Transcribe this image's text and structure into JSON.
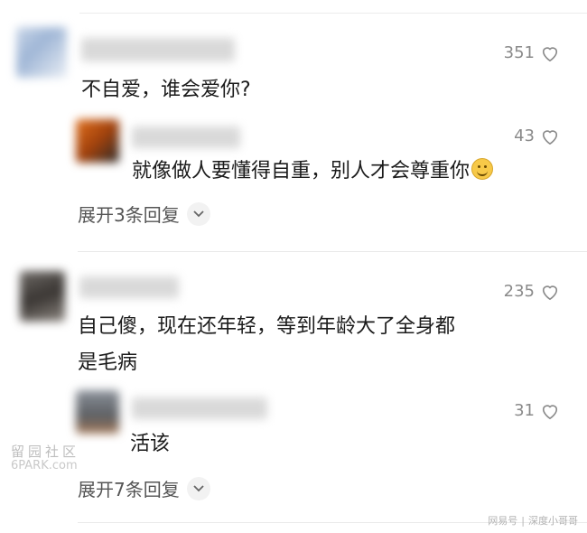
{
  "comments": [
    {
      "likes": "351",
      "text": "不自爱，谁会爱你?",
      "reply": {
        "likes": "43",
        "text": "就像做人要懂得自重，别人才会尊重你"
      },
      "expand_label": "展开3条回复"
    },
    {
      "likes": "235",
      "text_line1": "自己傻，现在还年轻，等到年龄大了全身都",
      "text_line2": "是毛病",
      "reply": {
        "likes": "31",
        "text": "活该"
      },
      "expand_label": "展开7条回复"
    }
  ],
  "watermark_left": {
    "line1": "留园社区",
    "line2": "6PARK.com"
  },
  "watermark_right": {
    "source": "网易号",
    "author": "深度小哥哥"
  },
  "icons": {
    "like": "heart-outline-icon",
    "expand": "chevron-down-icon",
    "emoji": "smile-emoji-icon"
  },
  "colors": {
    "text": "#1b1b1b",
    "meta": "#8a8a8a"
  }
}
